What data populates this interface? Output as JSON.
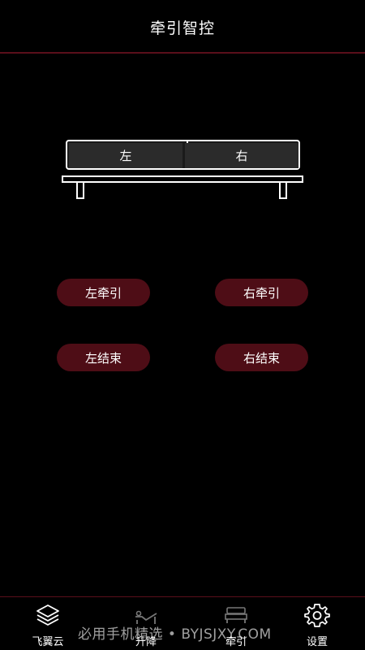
{
  "header": {
    "title": "牵引智控"
  },
  "bed": {
    "left_label": "左",
    "right_label": "右"
  },
  "buttons": {
    "left_traction": "左牵引",
    "right_traction": "右牵引",
    "left_end": "左结束",
    "right_end": "右结束"
  },
  "tabs": [
    {
      "label": "飞翼云",
      "icon": "layers-icon"
    },
    {
      "label": "升降",
      "icon": "recliner-icon"
    },
    {
      "label": "牵引",
      "icon": "bed-icon"
    },
    {
      "label": "设置",
      "icon": "gear-icon"
    }
  ],
  "watermark": "必用手机精选 • BYJSJXY.COM",
  "colors": {
    "background": "#000000",
    "accent": "#4e0d16",
    "divider": "#5a0f1a"
  }
}
